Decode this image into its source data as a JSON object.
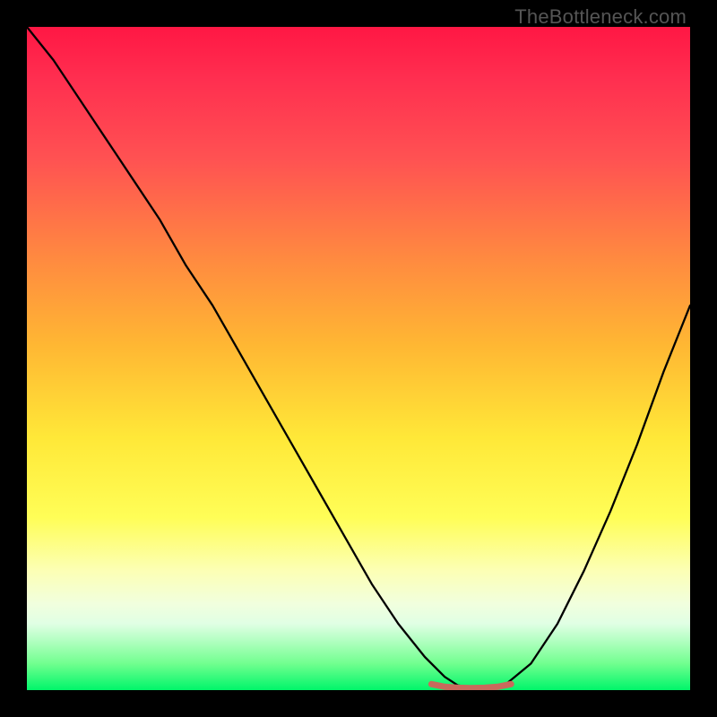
{
  "watermark": "TheBottleneck.com",
  "colors": {
    "curve": "#000000",
    "notch": "#c96a5c",
    "background_black": "#000000"
  },
  "chart_data": {
    "type": "line",
    "title": "",
    "xlabel": "",
    "ylabel": "",
    "xlim": [
      0,
      100
    ],
    "ylim": [
      0,
      100
    ],
    "grid": false,
    "legend": false,
    "series": [
      {
        "name": "bottleneck-curve",
        "x": [
          0,
          4,
          8,
          12,
          16,
          20,
          24,
          28,
          32,
          36,
          40,
          44,
          48,
          52,
          56,
          60,
          63,
          65,
          68,
          70,
          72,
          76,
          80,
          84,
          88,
          92,
          96,
          100
        ],
        "y": [
          100,
          95,
          89,
          83,
          77,
          71,
          64,
          58,
          51,
          44,
          37,
          30,
          23,
          16,
          10,
          5,
          2,
          0.7,
          0.3,
          0.3,
          0.7,
          4,
          10,
          18,
          27,
          37,
          48,
          58
        ]
      }
    ],
    "annotations": [
      {
        "name": "notch",
        "color": "#c96a5c",
        "stroke_width": 7,
        "x": [
          61,
          63,
          65,
          67,
          69,
          71,
          73
        ],
        "y": [
          0.9,
          0.5,
          0.35,
          0.3,
          0.35,
          0.5,
          0.9
        ]
      }
    ]
  }
}
